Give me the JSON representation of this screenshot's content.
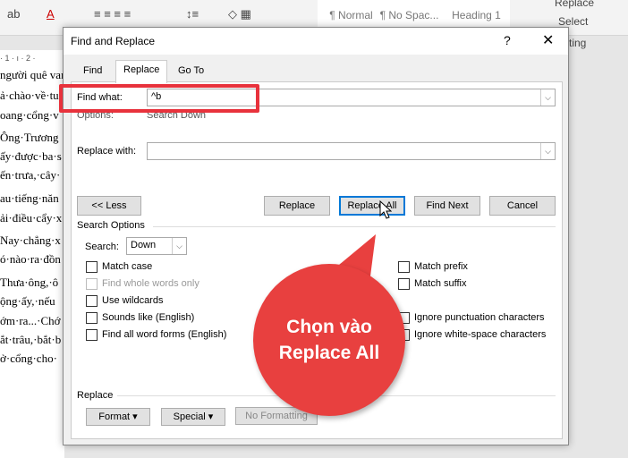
{
  "ribbon": {
    "styles": [
      "¶ Normal",
      "¶ No Spac...",
      "Heading 1"
    ],
    "replace": "Replace",
    "select": "Select",
    "editing": "ting"
  },
  "document": {
    "ruler": "· 1 · ı · 2 ·",
    "lines": [
      "người quê van",
      "ả·chào·về·tu",
      "oang·cổng·v",
      "Ông·Trương",
      "ấy·được·ba·s",
      "ến·trưa,·cây·",
      "au·tiếng·năn",
      "ải·điều·cẩy·x",
      "Nay·chẳng·x",
      "ó·nào·ra·đồn",
      "Thưa·ông,·ô",
      "ộng·ấy,·nếu",
      "ớm·ra...·Chớ",
      "ắt·trâu,·bắt·b",
      "ở·cổng·cho·"
    ]
  },
  "dialog": {
    "title": "Find and Replace",
    "help": "?",
    "close": "✕",
    "tabs": [
      "Find",
      "Replace",
      "Go To"
    ],
    "find_label": "Find what:",
    "find_value": "^b",
    "options_label": "Options:",
    "options_value": "Search Down",
    "replace_label": "Replace with:",
    "replace_value": "",
    "buttons": {
      "less": "<< Less",
      "replace": "Replace",
      "replace_all": "Replace All",
      "find_next": "Find Next",
      "cancel": "Cancel"
    },
    "search_options": "Search Options",
    "search_label": "Search:",
    "search_value": "Down",
    "left_options": [
      {
        "label": "Match case",
        "enabled": true
      },
      {
        "label": "Find whole words only",
        "enabled": false
      },
      {
        "label": "Use wildcards",
        "enabled": true
      },
      {
        "label": "Sounds like (English)",
        "enabled": true
      },
      {
        "label": "Find all word forms (English)",
        "enabled": true
      }
    ],
    "right_options": [
      "Match prefix",
      "Match suffix",
      "Ignore punctuation characters",
      "Ignore white-space characters"
    ],
    "replace_section": "Replace",
    "format": "Format ▾",
    "special": "Special ▾",
    "no_formatting": "No Formatting"
  },
  "callout": {
    "text": "Chọn vào Replace All",
    "color": "#e8403f"
  }
}
